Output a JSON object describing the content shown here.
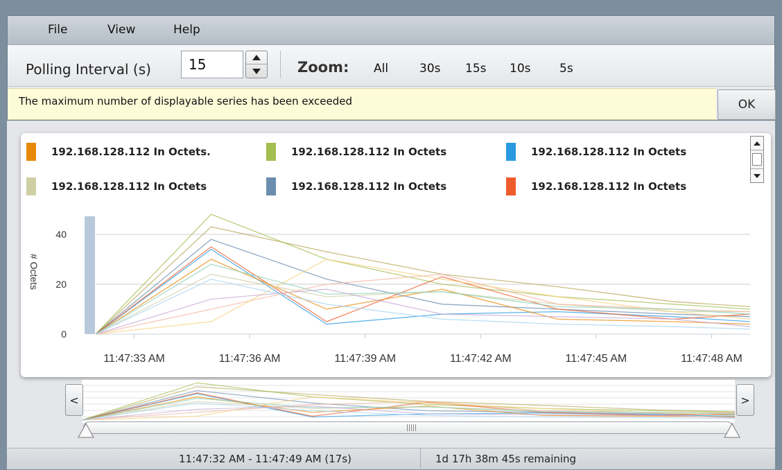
{
  "menu": {
    "items": [
      "File",
      "View",
      "Help"
    ]
  },
  "toolbar": {
    "polling_label": "Polling Interval (s)",
    "polling_value": "15",
    "zoom_label": "Zoom:",
    "zoom_options": [
      "All",
      "30s",
      "15s",
      "10s",
      "5s"
    ]
  },
  "alert": {
    "message": "The maximum number of displayable series has been exceeded",
    "ok_label": "OK",
    "background": "#fdfbd8"
  },
  "legend": [
    {
      "label": "192.168.128.112 In Octets.",
      "color": "#e8890c"
    },
    {
      "label": "192.168.128.112 In Octets",
      "color": "#a5be50"
    },
    {
      "label": "192.168.128.112 In Octets",
      "color": "#2a9ae2"
    },
    {
      "label": "192.168.128.112 In Octets",
      "color": "#cfcfa6"
    },
    {
      "label": "192.168.128.112 In Octets",
      "color": "#6b8eaf"
    },
    {
      "label": "192.168.128.112 In Octets",
      "color": "#ef5c2b"
    }
  ],
  "chart_data": {
    "type": "line",
    "ylabel": "# Octets",
    "xlabel": "",
    "ylim": [
      0,
      50
    ],
    "yticks": [
      0,
      20,
      40
    ],
    "x": [
      0,
      3,
      6,
      9,
      12,
      15,
      17
    ],
    "xticks": [
      {
        "t": 1,
        "label": "11:47:33 AM"
      },
      {
        "t": 4,
        "label": "11:47:36 AM"
      },
      {
        "t": 7,
        "label": "11:47:39 AM"
      },
      {
        "t": 10,
        "label": "11:47:42 AM"
      },
      {
        "t": 13,
        "label": "11:47:45 AM"
      },
      {
        "t": 16,
        "label": "11:47:48 AM"
      }
    ],
    "grid": true,
    "series": [
      {
        "color": "#b5a95a",
        "values": [
          0,
          43,
          33,
          24,
          19,
          13,
          11
        ]
      },
      {
        "color": "#a5be50",
        "values": [
          0,
          48,
          30,
          20,
          15,
          12,
          10
        ]
      },
      {
        "color": "#6b8eaf",
        "values": [
          0,
          38,
          22,
          12,
          10,
          8,
          7
        ]
      },
      {
        "color": "#2a9ae2",
        "values": [
          0,
          34,
          4,
          8,
          9,
          7,
          5
        ]
      },
      {
        "color": "#ef5c2b",
        "values": [
          0,
          35,
          5,
          23,
          10,
          6,
          8
        ]
      },
      {
        "color": "#e8890c",
        "values": [
          0,
          30,
          10,
          18,
          6,
          5,
          4
        ]
      },
      {
        "color": "#cfcfa6",
        "values": [
          0,
          24,
          15,
          17,
          12,
          9,
          9
        ]
      },
      {
        "color": "#f4b6a0",
        "values": [
          0,
          10,
          20,
          24,
          12,
          10,
          9
        ]
      },
      {
        "color": "#f7d27c",
        "values": [
          0,
          5,
          30,
          22,
          15,
          9,
          6
        ]
      },
      {
        "color": "#8fd0b8",
        "values": [
          0,
          28,
          16,
          17,
          11,
          10,
          8
        ]
      },
      {
        "color": "#c6a9d6",
        "values": [
          0,
          14,
          18,
          8,
          7,
          6,
          3
        ]
      },
      {
        "color": "#a8d4f2",
        "values": [
          0,
          22,
          12,
          6,
          4,
          3,
          2
        ]
      }
    ]
  },
  "navigator": {
    "left_label": "<",
    "right_label": ">",
    "range_text": "11:47:32 AM - 11:47:49 AM  (17s)",
    "remaining_text": "1d 17h 38m 45s remaining"
  }
}
